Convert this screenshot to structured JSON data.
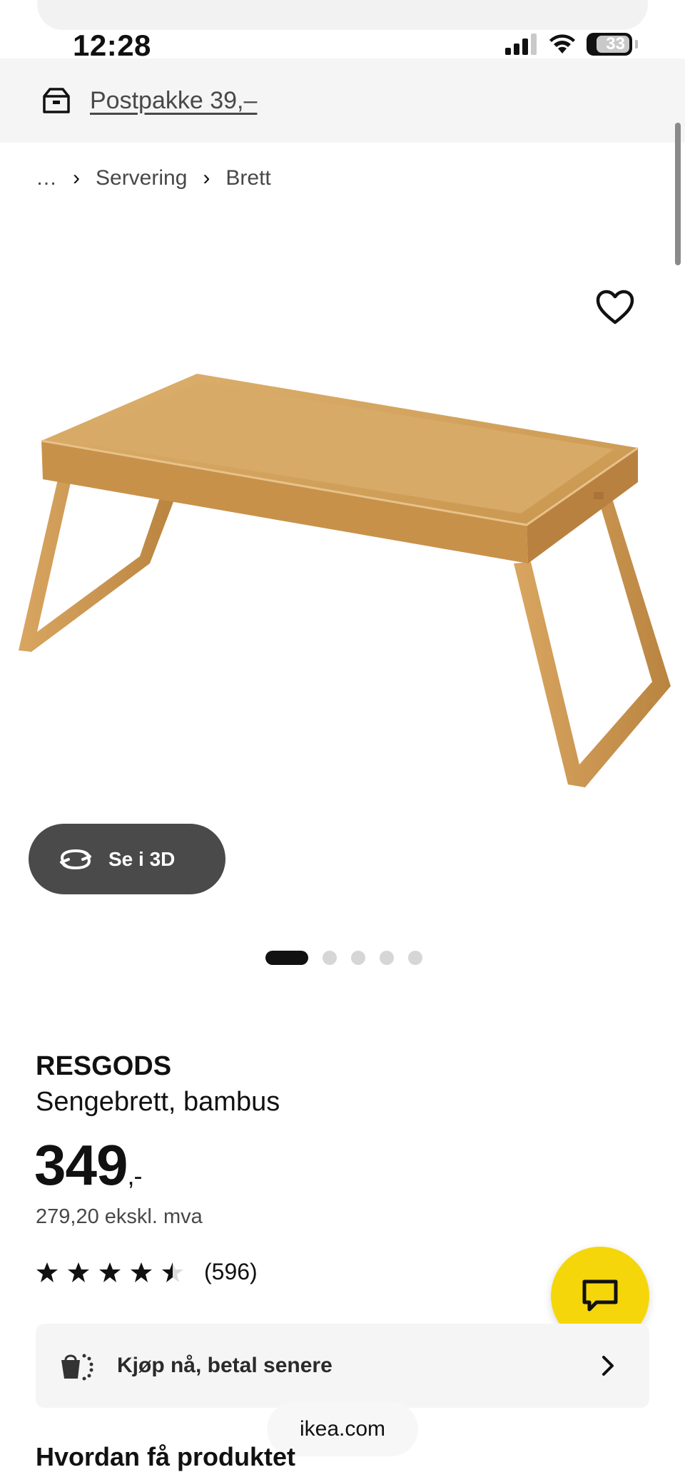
{
  "status_bar": {
    "time": "12:28",
    "battery": "33"
  },
  "delivery": {
    "icon": "package-icon",
    "text": "Postpakke 39,–"
  },
  "breadcrumb": {
    "items": [
      "…",
      "Servering",
      "Brett"
    ]
  },
  "product": {
    "image_alt": "bamboo bed tray",
    "view_3d_label": "Se i 3D",
    "image_count": 5,
    "active_image": 1,
    "name": "RESGODS",
    "description": "Sengebrett, bambus",
    "price": "349",
    "price_suffix": ",-",
    "price_ex_vat": "279,20 ekskl. mva",
    "rating_value": 4.5,
    "rating_max": 5,
    "rating_count": "(596)"
  },
  "payment": {
    "label": "Kjøp nå, betal senere"
  },
  "browser": {
    "url": "ikea.com"
  },
  "section": {
    "title": "Hvordan få produktet"
  },
  "colors": {
    "accent_yellow": "#f5d60a",
    "dark_button": "#4a4a4a",
    "banner_bg": "#f5f5f5"
  }
}
